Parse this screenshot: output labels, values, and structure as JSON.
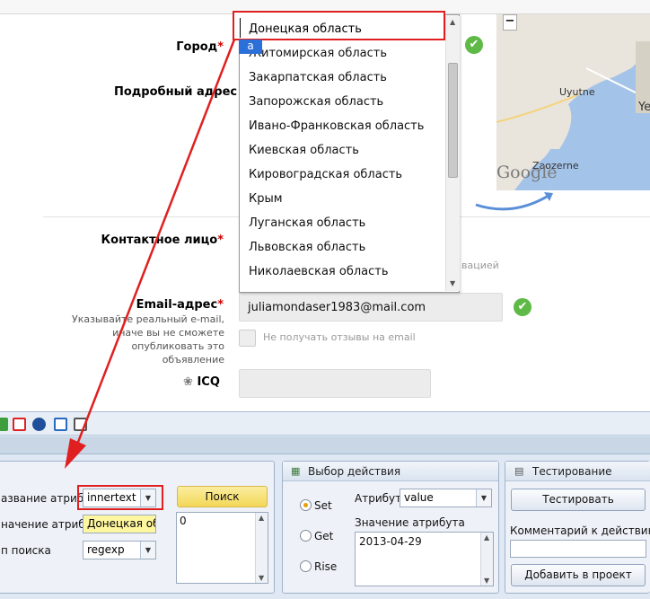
{
  "form": {
    "city_label": "Город",
    "required_mark": "*",
    "address_label": "Подробный адрес",
    "contact_label": "Контактное лицо",
    "email_label": "Email-адрес",
    "email_hint": "Указывайте реальный e-mail, иначе вы не сможете опубликовать это объявление",
    "email_value": "juliamondaser1983@mail.com",
    "email_checkbox_label": "Не получать отзывы на email",
    "icq_label": "ICQ",
    "partial_hint_text": "вацией",
    "ok_symbol": "✔"
  },
  "map": {
    "zoom_out": "−",
    "labels": [
      "Uyutne",
      "Zaozerne",
      "Ye"
    ],
    "logo": "Google"
  },
  "dropdown": {
    "selected": "Донецкая область",
    "typed_letter": "а",
    "items": [
      "Житомирская область",
      "Закарпатская область",
      "Запорожская область",
      "Ивано-Франковская область",
      "Киевская область",
      "Кировоградская область",
      "Крым",
      "Луганская область",
      "Львовская область",
      "Николаевская область"
    ]
  },
  "panel": {
    "search": {
      "attr_name_label": "азвание атрибута",
      "attr_name_value": "innertext",
      "attr_value_label": "начение атрибута",
      "attr_value_value": "Донецкая обла",
      "search_type_label": "п поиска",
      "search_type_value": "regexp",
      "search_button": "Поиск",
      "results": [
        "0"
      ]
    },
    "action": {
      "title": "Выбор действия",
      "options": [
        "Set",
        "Get",
        "Rise"
      ],
      "selected": "Set",
      "attribute_label": "Атрибут",
      "attribute_value": "value",
      "attr_value_label": "Значение атрибута",
      "attr_value_value": "2013-04-29"
    },
    "test": {
      "title": "Тестирование",
      "test_button": "Тестировать",
      "comment_label": "Комментарий к действию:",
      "comment_value": "",
      "add_button": "Добавить в проект"
    }
  },
  "colors": {
    "highlight_red": "#e02020",
    "ok_green": "#5fb946",
    "panel_bg": "#dfe8f3",
    "search_button_yellow": "#f7e27a"
  }
}
